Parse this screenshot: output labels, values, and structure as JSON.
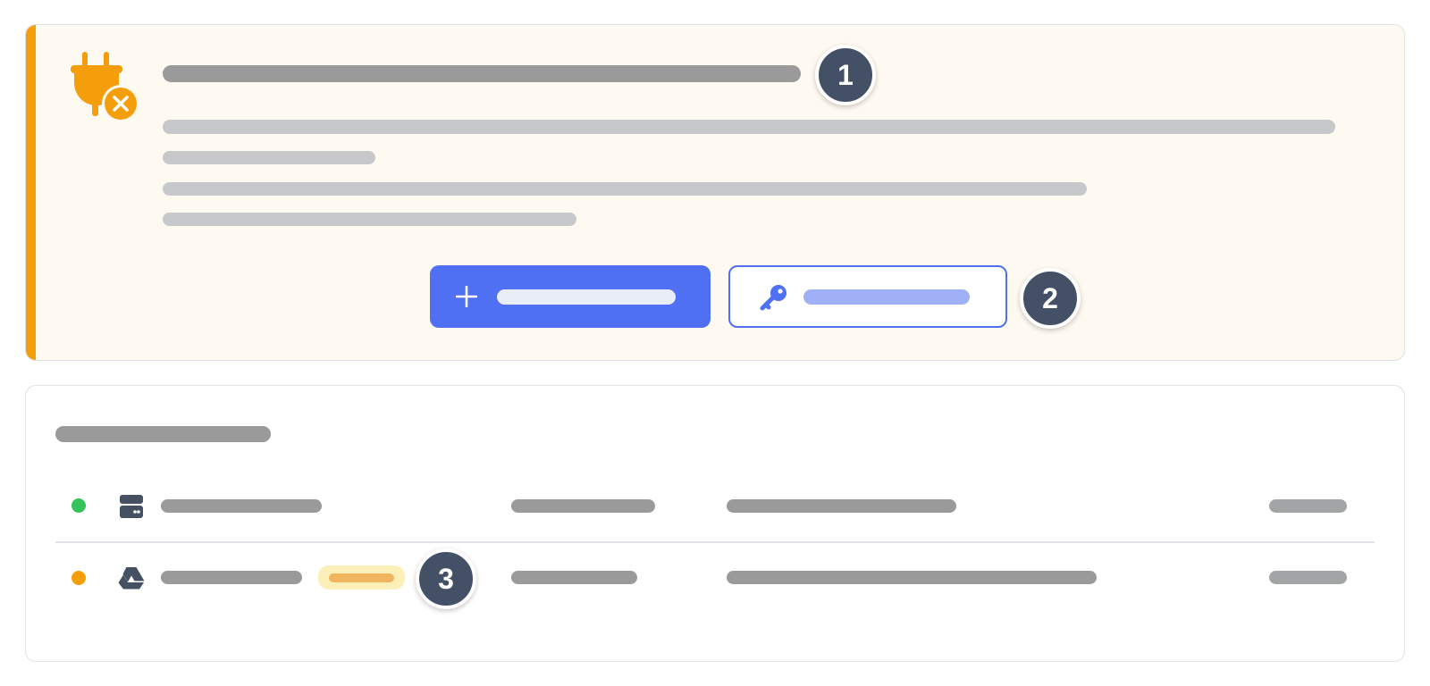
{
  "colors": {
    "accent": "#f59e0b",
    "primary": "#4f70f2",
    "badge": "#435066",
    "status_ok": "#34c35a",
    "status_warn": "#f59e0b",
    "pill_bg": "#fdefb8",
    "pill_fill": "#f2b55f"
  },
  "alert": {
    "icon": "unplugged-icon",
    "primary_button": {
      "icon": "plus-icon"
    },
    "secondary_button": {
      "icon": "key-icon"
    }
  },
  "list": {
    "rows": [
      {
        "status": "ok",
        "icon": "server-icon"
      },
      {
        "status": "warning",
        "icon": "drive-icon"
      }
    ]
  },
  "callouts": [
    "1",
    "2",
    "3"
  ]
}
